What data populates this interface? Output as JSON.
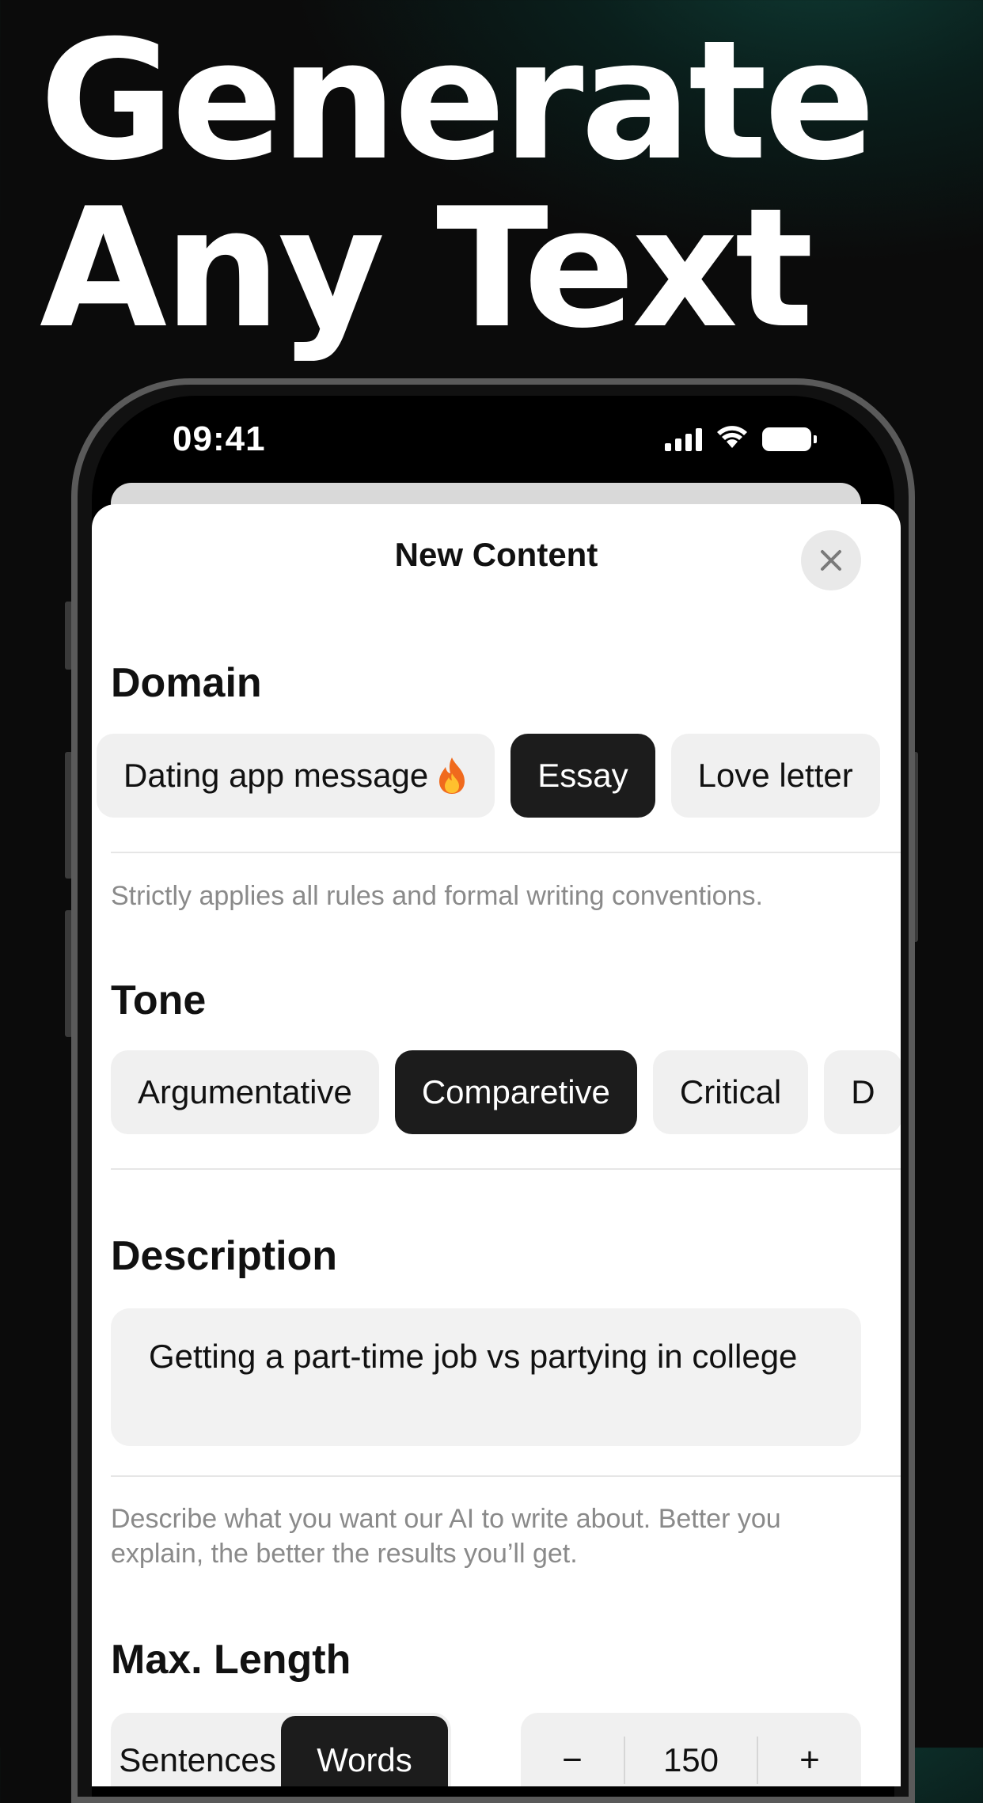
{
  "headline": {
    "line1": "Generate",
    "line2": "Any Text"
  },
  "status_bar": {
    "time": "09:41",
    "icons": [
      "signal-icon",
      "wifi-icon",
      "battery-icon"
    ]
  },
  "sheet": {
    "title": "New Content",
    "close_icon": "close-icon"
  },
  "domain": {
    "title": "Domain",
    "options": [
      {
        "label": "Dating app message",
        "icon": "fire-icon",
        "active": false
      },
      {
        "label": "Essay",
        "active": true
      },
      {
        "label": "Love letter",
        "active": false
      }
    ],
    "hint": "Strictly applies all rules and formal writing conventions."
  },
  "tone": {
    "title": "Tone",
    "options": [
      {
        "label": "Argumentative",
        "active": false
      },
      {
        "label": "Comparetive",
        "active": true
      },
      {
        "label": "Critical",
        "active": false
      },
      {
        "label": "D",
        "active": false
      }
    ]
  },
  "description": {
    "title": "Description",
    "value": "Getting a part-time job vs partying in college",
    "hint": "Describe what you want our AI to write about. Better you explain, the better the results you’ll get."
  },
  "max_length": {
    "title": "Max. Length",
    "units": [
      {
        "label": "Sentences",
        "active": false
      },
      {
        "label": "Words",
        "active": true
      }
    ],
    "value": "150",
    "decrement": "−",
    "increment": "+"
  },
  "colors": {
    "accent_dark": "#1c1c1c",
    "chip_bg": "#f0f0f0",
    "background": "#0b0b0b"
  }
}
